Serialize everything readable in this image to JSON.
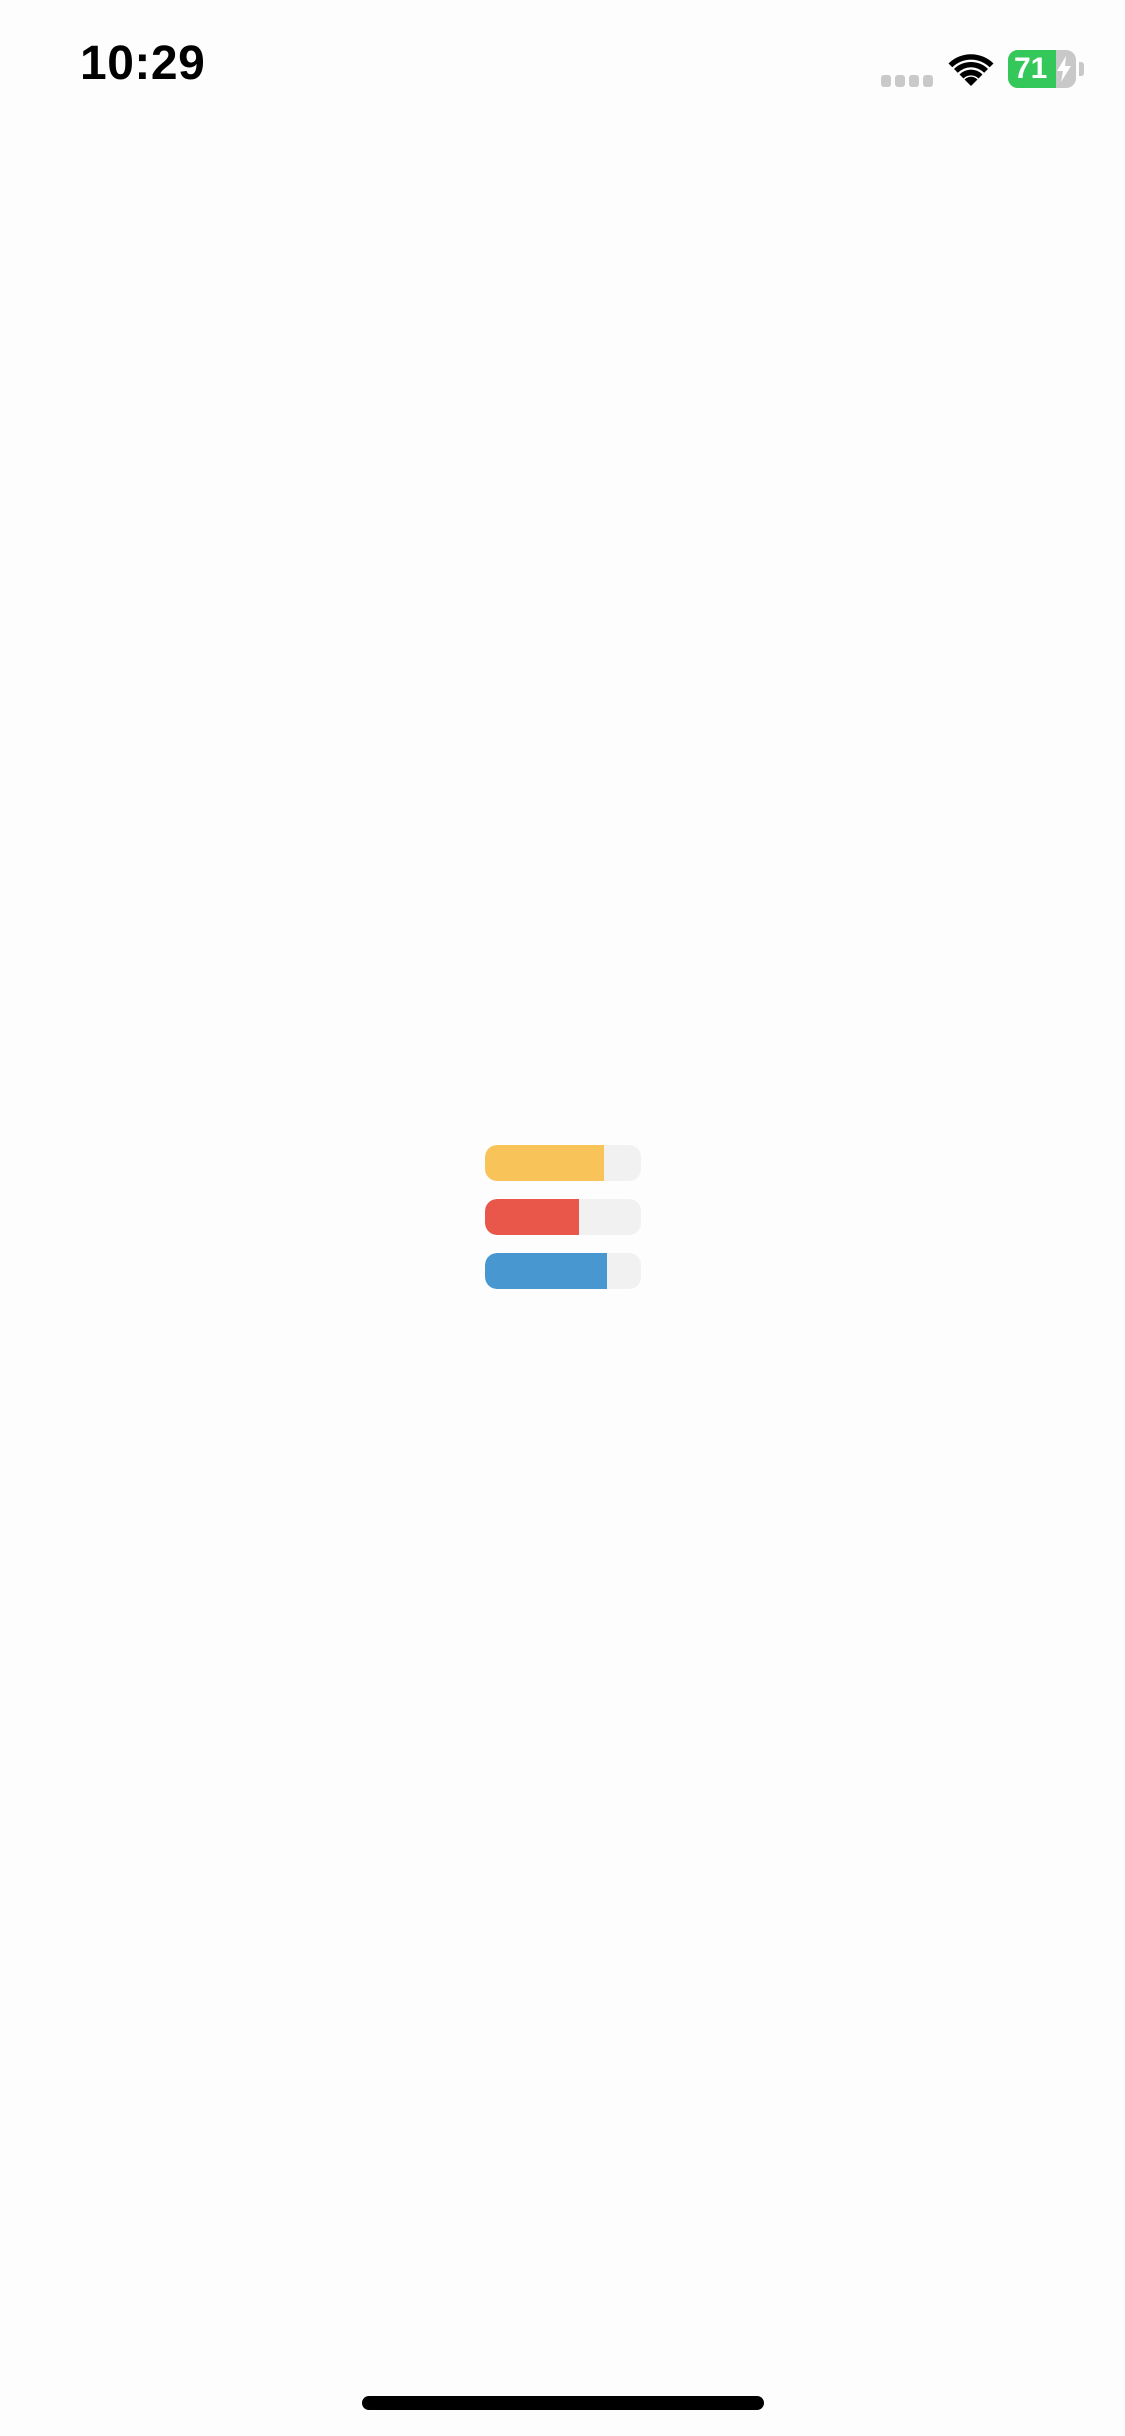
{
  "status_bar": {
    "time": "10:29",
    "signal_icon": "cellular-signal-icon",
    "wifi_icon": "wifi-icon",
    "battery": {
      "percent_label": "71",
      "level": 0.71,
      "charging": true,
      "icon": "battery-charging-icon",
      "fill_color": "#34c759"
    }
  },
  "loader": {
    "icon": "loading-bars-icon",
    "bars": [
      {
        "color": "#f8c45a",
        "fill": 0.76
      },
      {
        "color": "#e8574a",
        "fill": 0.6
      },
      {
        "color": "#4897d0",
        "fill": 0.78
      }
    ],
    "track_color": "#f1f1f1"
  },
  "home_indicator": {
    "color": "#000000"
  }
}
